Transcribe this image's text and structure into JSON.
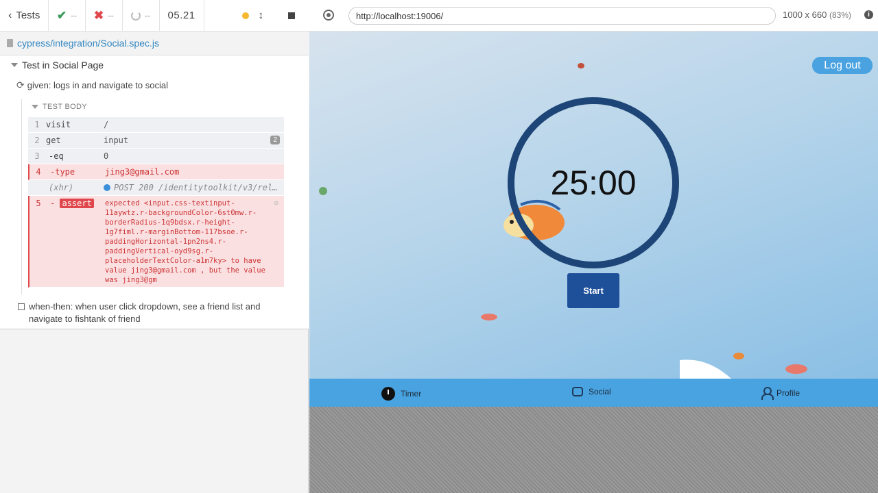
{
  "reporter": {
    "tests_label": "Tests",
    "passed": "--",
    "failed": "--",
    "pending": "--",
    "duration": "05.21",
    "spec_path": "cypress/integration/Social.spec.js",
    "suite_title": "Test in Social Page",
    "test_title": "given: logs in and navigate to social",
    "test_body_label": "TEST BODY",
    "commands": [
      {
        "num": "1",
        "name": "visit",
        "msg": "/"
      },
      {
        "num": "2",
        "name": "get",
        "msg": "input",
        "badge": "2"
      },
      {
        "num": "3",
        "name": "-eq",
        "msg": "0"
      },
      {
        "num": "4",
        "name": "-type",
        "msg": "jing3@gmail.com"
      },
      {
        "num": "",
        "name": "(xhr)",
        "msg": "POST 200 /identitytoolkit/v3/rel…"
      },
      {
        "num": "5",
        "name": "assert",
        "prefix": "-",
        "msg": "expected  <input.css-textinput-\n11aywtz.r-backgroundColor-6st0mw.r-\nborderRadius-1q9bdsx.r-height-\n1g7fiml.r-marginBottom-117bsoe.r-\npaddingHorizontal-1pn2ns4.r-\npaddingVertical-oyd9sg.r-\nplaceholderTextColor-a1m7ky>  to have\nvalue  jing3@gmail.com , but the value\nwas  jing3@gm"
      }
    ],
    "pending_test": "when-then: when user click dropdown, see a friend list and navigate to fishtank of friend"
  },
  "browser": {
    "url": "http://localhost:19006/",
    "viewport": "1000 x 660",
    "zoom": "(83%)"
  },
  "app": {
    "logout_label": "Log out",
    "timer_value": "25:00",
    "start_label": "Start",
    "tabs": [
      {
        "label": "Timer",
        "icon": "clock-icon"
      },
      {
        "label": "Social",
        "icon": "fishbowl-icon"
      },
      {
        "label": "Profile",
        "icon": "person-icon"
      }
    ],
    "colors": {
      "tab_bar": "#49a3e1",
      "start_button": "#1e4f99",
      "timer_ring": "#1d4577",
      "logout_button": "#4aa3e0"
    }
  }
}
